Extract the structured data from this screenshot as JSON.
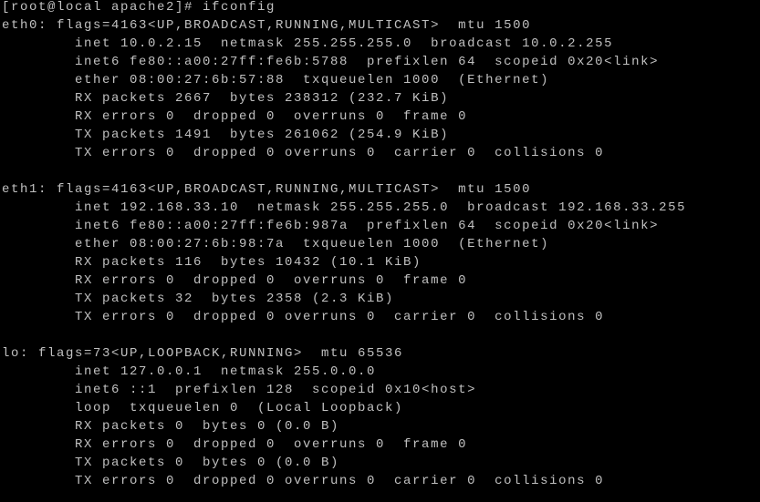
{
  "terminal": {
    "colors": {
      "background": "#000000",
      "text": "#c0c0c0"
    },
    "lines": [
      "[root@local apache2]# ifconfig",
      "eth0: flags=4163<UP,BROADCAST,RUNNING,MULTICAST>  mtu 1500",
      "        inet 10.0.2.15  netmask 255.255.255.0  broadcast 10.0.2.255",
      "        inet6 fe80::a00:27ff:fe6b:5788  prefixlen 64  scopeid 0x20<link>",
      "        ether 08:00:27:6b:57:88  txqueuelen 1000  (Ethernet)",
      "        RX packets 2667  bytes 238312 (232.7 KiB)",
      "        RX errors 0  dropped 0  overruns 0  frame 0",
      "        TX packets 1491  bytes 261062 (254.9 KiB)",
      "        TX errors 0  dropped 0 overruns 0  carrier 0  collisions 0",
      "",
      "eth1: flags=4163<UP,BROADCAST,RUNNING,MULTICAST>  mtu 1500",
      "        inet 192.168.33.10  netmask 255.255.255.0  broadcast 192.168.33.255",
      "        inet6 fe80::a00:27ff:fe6b:987a  prefixlen 64  scopeid 0x20<link>",
      "        ether 08:00:27:6b:98:7a  txqueuelen 1000  (Ethernet)",
      "        RX packets 116  bytes 10432 (10.1 KiB)",
      "        RX errors 0  dropped 0  overruns 0  frame 0",
      "        TX packets 32  bytes 2358 (2.3 KiB)",
      "        TX errors 0  dropped 0 overruns 0  carrier 0  collisions 0",
      "",
      "lo: flags=73<UP,LOOPBACK,RUNNING>  mtu 65536",
      "        inet 127.0.0.1  netmask 255.0.0.0",
      "        inet6 ::1  prefixlen 128  scopeid 0x10<host>",
      "        loop  txqueuelen 0  (Local Loopback)",
      "        RX packets 0  bytes 0 (0.0 B)",
      "        RX errors 0  dropped 0  overruns 0  frame 0",
      "        TX packets 0  bytes 0 (0.0 B)",
      "        TX errors 0  dropped 0 overruns 0  carrier 0  collisions 0"
    ]
  }
}
